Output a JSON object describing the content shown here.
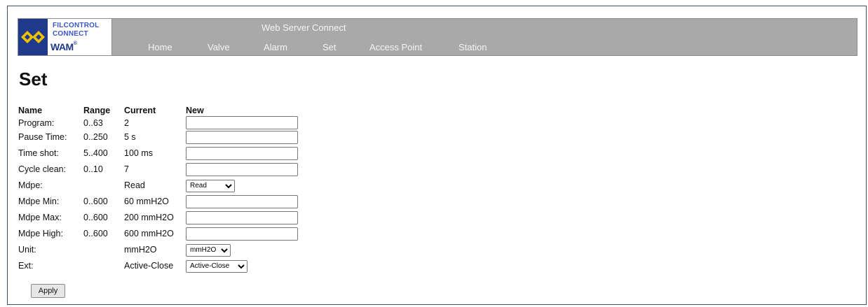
{
  "header": {
    "logo_line1": "FILCONTROL",
    "logo_line2": "CONNECT",
    "logo_brand": "WAM",
    "logo_brand_mark": "®",
    "app_title": "Web Server Connect",
    "nav": [
      "Home",
      "Valve",
      "Alarm",
      "Set",
      "Access Point",
      "Station"
    ],
    "colors": {
      "bar": "#a9a9a9",
      "logo_blue": "#1f3a8a",
      "logo_diamond": "#f2c200"
    }
  },
  "page": {
    "title": "Set"
  },
  "table": {
    "headers": {
      "name": "Name",
      "range": "Range",
      "current": "Current",
      "new": "New"
    },
    "rows": [
      {
        "name": "Program:",
        "range": "0..63",
        "current": "2",
        "new": "",
        "type": "text"
      },
      {
        "name": "Pause Time:",
        "range": "0..250",
        "current": "5 s",
        "new": "",
        "type": "text"
      },
      {
        "name": "Time shot:",
        "range": "5..400",
        "current": "100 ms",
        "new": "",
        "type": "text"
      },
      {
        "name": "Cycle clean:",
        "range": "0..10",
        "current": "7",
        "new": "",
        "type": "text"
      },
      {
        "name": "Mdpe:",
        "range": "",
        "current": "Read",
        "new": "Read",
        "type": "select"
      },
      {
        "name": "Mdpe Min:",
        "range": "0..600",
        "current": "60 mmH2O",
        "new": "",
        "type": "text"
      },
      {
        "name": "Mdpe Max:",
        "range": "0..600",
        "current": "200 mmH2O",
        "new": "",
        "type": "text"
      },
      {
        "name": "Mdpe High:",
        "range": "0..600",
        "current": "600 mmH2O",
        "new": "",
        "type": "text"
      },
      {
        "name": "Unit:",
        "range": "",
        "current": "mmH2O",
        "new": "mmH2O",
        "type": "select"
      },
      {
        "name": "Ext:",
        "range": "",
        "current": "Active-Close",
        "new": "Active-Close",
        "type": "select"
      }
    ]
  },
  "actions": {
    "apply_label": "Apply"
  }
}
